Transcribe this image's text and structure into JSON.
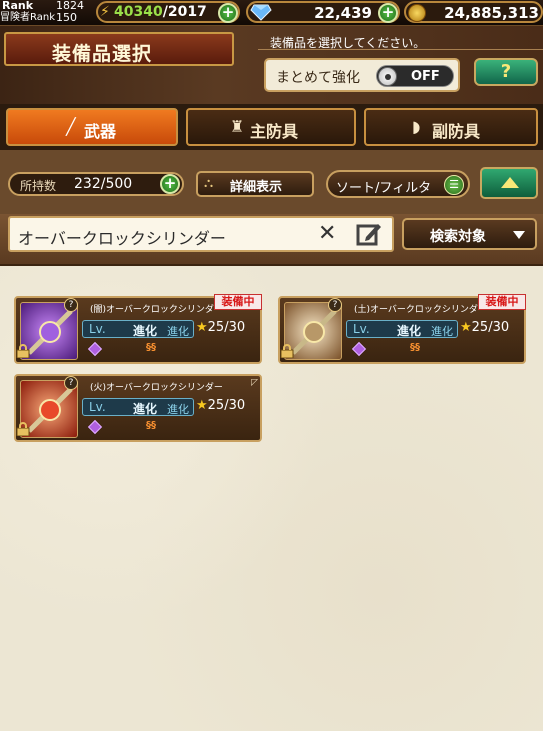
{
  "status": {
    "rank_label": "Rank",
    "rank_value": "1824",
    "adv_rank_label": "冒険者Rank",
    "adv_rank_value": "150",
    "stamina_current": "40340",
    "stamina_max": "/2017",
    "gems": "22,439",
    "coins": "24,885,313"
  },
  "header": {
    "title": "装備品選択",
    "subtitle": "装備品を選択してください。",
    "bulk_label": "まとめて強化",
    "bulk_toggle": "OFF",
    "help_label": "?"
  },
  "tabs": [
    {
      "label": "武器",
      "icon": "sword-icon",
      "active": true
    },
    {
      "label": "主防具",
      "icon": "armor-icon",
      "active": false
    },
    {
      "label": "副防具",
      "icon": "shield-icon",
      "active": false
    }
  ],
  "filter": {
    "owned_label": "所持数",
    "owned_value": "232/500",
    "detail_label": "詳細表示",
    "sort_label": "ソート/フィルタ"
  },
  "search": {
    "value": "オーバークロックシリンダー",
    "target_label": "検索対象"
  },
  "items": [
    {
      "name": "(闇)オーバークロックシリンダー",
      "equipped": "装備中",
      "lv": "Lv.",
      "evo": "進化",
      "evo2": "進化",
      "stars": "25/30",
      "thumb_color": "#7a3ab8"
    },
    {
      "name": "(土)オーバークロックシリンダー",
      "equipped": "装備中",
      "lv": "Lv.",
      "evo": "進化",
      "evo2": "進化",
      "stars": "25/30",
      "thumb_color": "#9a6a38"
    },
    {
      "name": "(火)オーバークロックシリンダー",
      "equipped": "",
      "lv": "Lv.",
      "evo": "進化",
      "evo2": "進化",
      "stars": "25/30",
      "thumb_color": "#c83a1a"
    }
  ]
}
